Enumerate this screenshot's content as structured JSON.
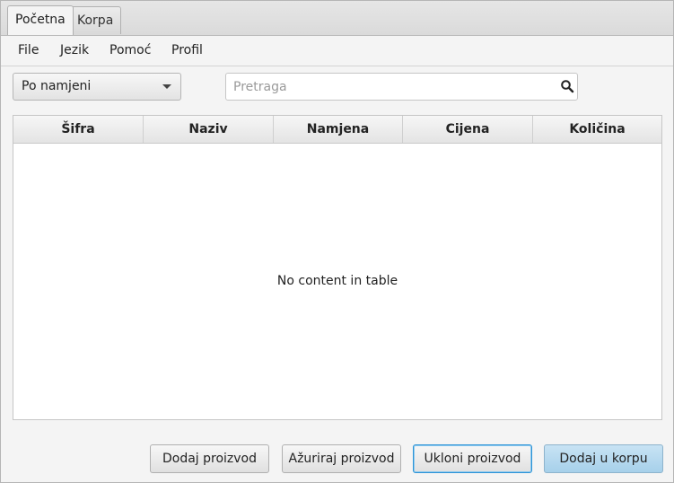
{
  "tabs": [
    {
      "label": "Početna",
      "active": true
    },
    {
      "label": "Korpa",
      "active": false
    }
  ],
  "menu": [
    "File",
    "Jezik",
    "Pomoć",
    "Profil"
  ],
  "filter": {
    "selected": "Po namjeni"
  },
  "search": {
    "placeholder": "Pretraga",
    "value": ""
  },
  "table": {
    "columns": [
      "Šifra",
      "Naziv",
      "Namjena",
      "Cijena",
      "Količina"
    ],
    "rows": [],
    "empty_text": "No content in table"
  },
  "buttons": {
    "add_product": "Dodaj proizvod",
    "update_product": "Ažuriraj proizvod",
    "remove_product": "Ukloni proizvod",
    "add_to_cart": "Dodaj u korpu"
  },
  "colors": {
    "focus_border": "#2b93d6",
    "primary_button": "#a6d0ea"
  }
}
